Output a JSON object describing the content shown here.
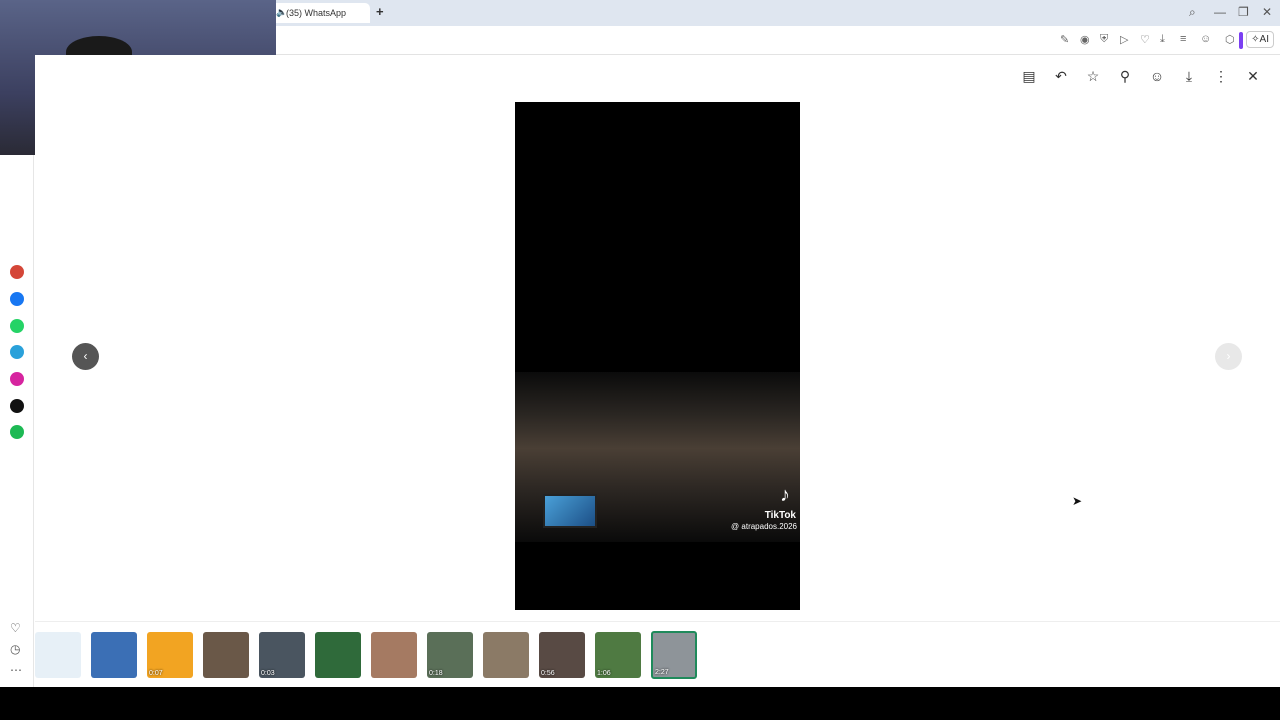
{
  "browser": {
    "tab_title": "(35) WhatsApp",
    "new_tab_label": "+",
    "ai_label": "AI",
    "window_controls": {
      "minimize": "—",
      "restore": "❐",
      "close": "✕"
    }
  },
  "toolbar_icons": [
    "edit-icon",
    "camera-icon",
    "shield-icon",
    "play-icon",
    "heart-icon",
    "download-icon",
    "menu-icon",
    "profile-icon",
    "extensions-icon"
  ],
  "sidebar": {
    "apps": [
      {
        "name": "gmail",
        "color": "#d44638"
      },
      {
        "name": "messenger",
        "color": "#1877f2"
      },
      {
        "name": "whatsapp",
        "color": "#25d366"
      },
      {
        "name": "telegram",
        "color": "#2aa1da"
      },
      {
        "name": "instagram",
        "color": "#d6249f"
      },
      {
        "name": "tiktok",
        "color": "#111111"
      },
      {
        "name": "spotify",
        "color": "#1db954"
      }
    ]
  },
  "viewer": {
    "actions": [
      "message-icon",
      "reply-icon",
      "star-icon",
      "pin-icon",
      "emoji-icon",
      "download-icon",
      "more-icon",
      "close-icon"
    ],
    "video": {
      "watermark_name": "TikTok",
      "watermark_handle": "@ atrapados.2026"
    },
    "nav_prev": "‹",
    "nav_next": "›"
  },
  "thumbnails": [
    {
      "duration": "",
      "color": "#e7f0f7"
    },
    {
      "duration": "",
      "color": "#3b6fb5"
    },
    {
      "duration": "0:07",
      "color": "#f2a422"
    },
    {
      "duration": "",
      "color": "#6a5848"
    },
    {
      "duration": "0:03",
      "color": "#4a5560"
    },
    {
      "duration": "",
      "color": "#2f6a3a"
    },
    {
      "duration": "",
      "color": "#a57a62"
    },
    {
      "duration": "0:18",
      "color": "#5a6f58"
    },
    {
      "duration": "",
      "color": "#8b7a66"
    },
    {
      "duration": "0:56",
      "color": "#584a44"
    },
    {
      "duration": "1:06",
      "color": "#4f7a42"
    },
    {
      "duration": "2:27",
      "color": "#8e9499",
      "selected": true
    }
  ]
}
